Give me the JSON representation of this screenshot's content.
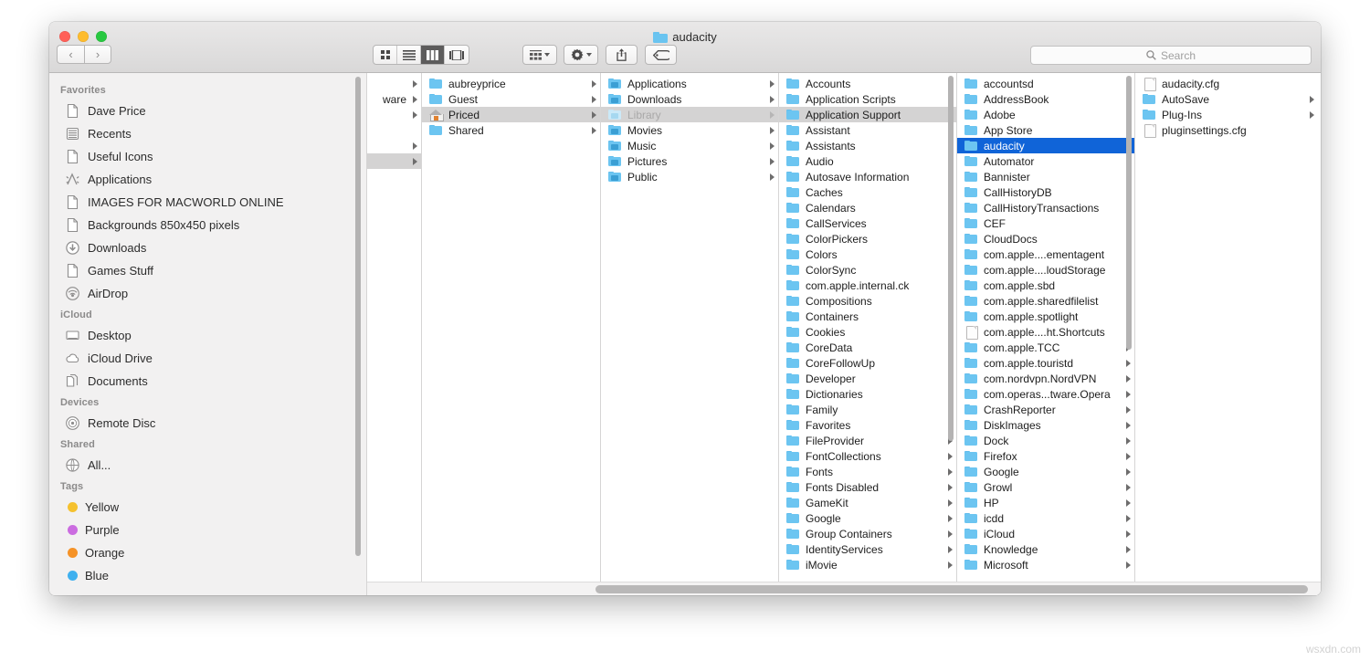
{
  "window": {
    "title": "audacity",
    "title_icon": "folder-icon",
    "traffic_lights": [
      "close-red",
      "minimize-yellow",
      "maximize-green"
    ],
    "back_glyph": "‹",
    "forward_glyph": "›"
  },
  "toolbar": {
    "view_modes": [
      {
        "name": "icon-view",
        "glyph": "∷",
        "active": false
      },
      {
        "name": "list-view",
        "glyph": "≡",
        "active": false
      },
      {
        "name": "column-view",
        "glyph": "███",
        "active": true
      },
      {
        "name": "gallery-view",
        "glyph": "|□|",
        "active": false
      }
    ],
    "arrange_label": "arrange-icon",
    "action_label": "⚙",
    "share_label": "⇧",
    "tag_label": "◇",
    "arrange_glyph": "∷∷",
    "gear_glyph": "⚙",
    "share_glyph": "⬆",
    "tag_glyph": "●"
  },
  "search": {
    "placeholder": "Search",
    "icon": "search-icon",
    "value": ""
  },
  "sidebar": {
    "sections": [
      {
        "header": "Favorites",
        "items": [
          {
            "label": "Dave Price",
            "icon": "document-icon"
          },
          {
            "label": "Recents",
            "icon": "recents-icon"
          },
          {
            "label": "Useful Icons",
            "icon": "document-icon"
          },
          {
            "label": "Applications",
            "icon": "applications-icon"
          },
          {
            "label": "IMAGES FOR MACWORLD ONLINE",
            "icon": "document-icon"
          },
          {
            "label": "Backgrounds 850x450 pixels",
            "icon": "document-icon"
          },
          {
            "label": "Downloads",
            "icon": "downloads-icon"
          },
          {
            "label": "Games Stuff",
            "icon": "document-icon"
          },
          {
            "label": "AirDrop",
            "icon": "airdrop-icon"
          }
        ]
      },
      {
        "header": "iCloud",
        "items": [
          {
            "label": "Desktop",
            "icon": "desktop-icon"
          },
          {
            "label": "iCloud Drive",
            "icon": "cloud-icon"
          },
          {
            "label": "Documents",
            "icon": "documents-icon"
          }
        ]
      },
      {
        "header": "Devices",
        "items": [
          {
            "label": "Remote Disc",
            "icon": "disc-icon"
          }
        ]
      },
      {
        "header": "Shared",
        "items": [
          {
            "label": "All...",
            "icon": "globe-icon"
          }
        ]
      },
      {
        "header": "Tags",
        "items": [
          {
            "label": "Yellow",
            "icon": "tag-dot",
            "color": "#f5c12e"
          },
          {
            "label": "Purple",
            "icon": "tag-dot",
            "color": "#cb6ce0"
          },
          {
            "label": "Orange",
            "icon": "tag-dot",
            "color": "#f59227"
          },
          {
            "label": "Blue",
            "icon": "tag-dot",
            "color": "#3fb0ef"
          }
        ]
      }
    ]
  },
  "columns": [
    {
      "name": "column-partial",
      "truncated_label": "ware",
      "rows": [
        {
          "label": "",
          "icon": "none",
          "chevron": true,
          "state": "normal"
        },
        {
          "label": "ware",
          "icon": "none",
          "chevron": true,
          "state": "normal"
        },
        {
          "label": "",
          "icon": "none",
          "chevron": true,
          "state": "normal"
        },
        {
          "label": "",
          "icon": "none",
          "chevron": false,
          "state": "normal"
        },
        {
          "label": "",
          "icon": "none",
          "chevron": true,
          "state": "normal"
        },
        {
          "label": "",
          "icon": "none",
          "chevron": true,
          "state": "selected-inactive"
        }
      ]
    },
    {
      "name": "column-users",
      "rows": [
        {
          "label": "aubreyprice",
          "icon": "folder-icon",
          "chevron": true,
          "state": "normal"
        },
        {
          "label": "Guest",
          "icon": "folder-icon",
          "chevron": true,
          "state": "normal"
        },
        {
          "label": "Priced",
          "icon": "home-icon",
          "chevron": true,
          "state": "selected-inactive"
        },
        {
          "label": "Shared",
          "icon": "folder-icon",
          "chevron": true,
          "state": "normal"
        }
      ]
    },
    {
      "name": "column-home",
      "rows": [
        {
          "label": "Applications",
          "icon": "folder-app-icon",
          "chevron": true,
          "state": "normal"
        },
        {
          "label": "Downloads",
          "icon": "folder-downloads-icon",
          "chevron": true,
          "state": "normal"
        },
        {
          "label": "Library",
          "icon": "folder-library-icon",
          "chevron": true,
          "state": "selected-inactive-dim"
        },
        {
          "label": "Movies",
          "icon": "folder-movies-icon",
          "chevron": true,
          "state": "normal"
        },
        {
          "label": "Music",
          "icon": "folder-music-icon",
          "chevron": true,
          "state": "normal"
        },
        {
          "label": "Pictures",
          "icon": "folder-pictures-icon",
          "chevron": true,
          "state": "normal"
        },
        {
          "label": "Public",
          "icon": "folder-public-icon",
          "chevron": true,
          "state": "normal"
        }
      ]
    },
    {
      "name": "column-library",
      "scrollbar": true,
      "rows": [
        {
          "label": "Accounts",
          "icon": "folder-icon",
          "chevron": true,
          "state": "normal"
        },
        {
          "label": "Application Scripts",
          "icon": "folder-icon",
          "chevron": true,
          "state": "normal"
        },
        {
          "label": "Application Support",
          "icon": "folder-icon",
          "chevron": true,
          "state": "selected-inactive"
        },
        {
          "label": "Assistant",
          "icon": "folder-icon",
          "chevron": true,
          "state": "normal"
        },
        {
          "label": "Assistants",
          "icon": "folder-icon",
          "chevron": true,
          "state": "normal"
        },
        {
          "label": "Audio",
          "icon": "folder-icon",
          "chevron": true,
          "state": "normal"
        },
        {
          "label": "Autosave Information",
          "icon": "folder-icon",
          "chevron": true,
          "state": "normal"
        },
        {
          "label": "Caches",
          "icon": "folder-icon",
          "chevron": true,
          "state": "normal"
        },
        {
          "label": "Calendars",
          "icon": "folder-icon",
          "chevron": true,
          "state": "normal"
        },
        {
          "label": "CallServices",
          "icon": "folder-icon",
          "chevron": true,
          "state": "normal"
        },
        {
          "label": "ColorPickers",
          "icon": "folder-icon",
          "chevron": true,
          "state": "normal"
        },
        {
          "label": "Colors",
          "icon": "folder-icon",
          "chevron": true,
          "state": "normal"
        },
        {
          "label": "ColorSync",
          "icon": "folder-icon",
          "chevron": true,
          "state": "normal"
        },
        {
          "label": "com.apple.internal.ck",
          "icon": "folder-icon",
          "chevron": true,
          "state": "normal"
        },
        {
          "label": "Compositions",
          "icon": "folder-icon",
          "chevron": true,
          "state": "normal"
        },
        {
          "label": "Containers",
          "icon": "folder-icon",
          "chevron": true,
          "state": "normal"
        },
        {
          "label": "Cookies",
          "icon": "folder-icon",
          "chevron": true,
          "state": "normal"
        },
        {
          "label": "CoreData",
          "icon": "folder-icon",
          "chevron": true,
          "state": "normal"
        },
        {
          "label": "CoreFollowUp",
          "icon": "folder-icon",
          "chevron": true,
          "state": "normal"
        },
        {
          "label": "Developer",
          "icon": "folder-icon",
          "chevron": true,
          "state": "normal"
        },
        {
          "label": "Dictionaries",
          "icon": "folder-icon",
          "chevron": true,
          "state": "normal"
        },
        {
          "label": "Family",
          "icon": "folder-icon",
          "chevron": true,
          "state": "normal"
        },
        {
          "label": "Favorites",
          "icon": "folder-icon",
          "chevron": true,
          "state": "normal"
        },
        {
          "label": "FileProvider",
          "icon": "folder-icon",
          "chevron": true,
          "state": "normal"
        },
        {
          "label": "FontCollections",
          "icon": "folder-icon",
          "chevron": true,
          "state": "normal"
        },
        {
          "label": "Fonts",
          "icon": "folder-icon",
          "chevron": true,
          "state": "normal"
        },
        {
          "label": "Fonts Disabled",
          "icon": "folder-icon",
          "chevron": true,
          "state": "normal"
        },
        {
          "label": "GameKit",
          "icon": "folder-icon",
          "chevron": true,
          "state": "normal"
        },
        {
          "label": "Google",
          "icon": "folder-icon",
          "chevron": true,
          "state": "normal"
        },
        {
          "label": "Group Containers",
          "icon": "folder-icon",
          "chevron": true,
          "state": "normal"
        },
        {
          "label": "IdentityServices",
          "icon": "folder-icon",
          "chevron": true,
          "state": "normal"
        },
        {
          "label": "iMovie",
          "icon": "folder-icon",
          "chevron": true,
          "state": "normal"
        }
      ]
    },
    {
      "name": "column-application-support",
      "scrollbar": true,
      "rows": [
        {
          "label": "accountsd",
          "icon": "folder-icon",
          "chevron": true,
          "state": "normal"
        },
        {
          "label": "AddressBook",
          "icon": "folder-icon",
          "chevron": true,
          "state": "normal"
        },
        {
          "label": "Adobe",
          "icon": "folder-icon",
          "chevron": true,
          "state": "normal"
        },
        {
          "label": "App Store",
          "icon": "folder-icon",
          "chevron": true,
          "state": "normal"
        },
        {
          "label": "audacity",
          "icon": "folder-icon",
          "chevron": true,
          "state": "selected-active"
        },
        {
          "label": "Automator",
          "icon": "folder-icon",
          "chevron": true,
          "state": "normal"
        },
        {
          "label": "Bannister",
          "icon": "folder-icon",
          "chevron": true,
          "state": "normal"
        },
        {
          "label": "CallHistoryDB",
          "icon": "folder-icon",
          "chevron": true,
          "state": "normal"
        },
        {
          "label": "CallHistoryTransactions",
          "icon": "folder-icon",
          "chevron": true,
          "state": "normal"
        },
        {
          "label": "CEF",
          "icon": "folder-icon",
          "chevron": true,
          "state": "normal"
        },
        {
          "label": "CloudDocs",
          "icon": "folder-icon",
          "chevron": true,
          "state": "normal"
        },
        {
          "label": "com.apple....ementagent",
          "icon": "folder-icon",
          "chevron": true,
          "state": "normal"
        },
        {
          "label": "com.apple....loudStorage",
          "icon": "folder-icon",
          "chevron": true,
          "state": "normal"
        },
        {
          "label": "com.apple.sbd",
          "icon": "folder-icon",
          "chevron": true,
          "state": "normal"
        },
        {
          "label": "com.apple.sharedfilelist",
          "icon": "folder-icon",
          "chevron": true,
          "state": "normal"
        },
        {
          "label": "com.apple.spotlight",
          "icon": "folder-icon",
          "chevron": true,
          "state": "normal"
        },
        {
          "label": "com.apple....ht.Shortcuts",
          "icon": "document-icon",
          "chevron": false,
          "state": "normal"
        },
        {
          "label": "com.apple.TCC",
          "icon": "folder-icon",
          "chevron": true,
          "state": "normal"
        },
        {
          "label": "com.apple.touristd",
          "icon": "folder-icon",
          "chevron": true,
          "state": "normal"
        },
        {
          "label": "com.nordvpn.NordVPN",
          "icon": "folder-icon",
          "chevron": true,
          "state": "normal"
        },
        {
          "label": "com.operas...tware.Opera",
          "icon": "folder-icon",
          "chevron": true,
          "state": "normal"
        },
        {
          "label": "CrashReporter",
          "icon": "folder-icon",
          "chevron": true,
          "state": "normal"
        },
        {
          "label": "DiskImages",
          "icon": "folder-icon",
          "chevron": true,
          "state": "normal"
        },
        {
          "label": "Dock",
          "icon": "folder-icon",
          "chevron": true,
          "state": "normal"
        },
        {
          "label": "Firefox",
          "icon": "folder-icon",
          "chevron": true,
          "state": "normal"
        },
        {
          "label": "Google",
          "icon": "folder-icon",
          "chevron": true,
          "state": "normal"
        },
        {
          "label": "Growl",
          "icon": "folder-icon",
          "chevron": true,
          "state": "normal"
        },
        {
          "label": "HP",
          "icon": "folder-icon",
          "chevron": true,
          "state": "normal"
        },
        {
          "label": "icdd",
          "icon": "folder-icon",
          "chevron": true,
          "state": "normal"
        },
        {
          "label": "iCloud",
          "icon": "folder-icon",
          "chevron": true,
          "state": "normal"
        },
        {
          "label": "Knowledge",
          "icon": "folder-icon",
          "chevron": true,
          "state": "normal"
        },
        {
          "label": "Microsoft",
          "icon": "folder-icon",
          "chevron": true,
          "state": "normal"
        }
      ]
    },
    {
      "name": "column-audacity",
      "rows": [
        {
          "label": "audacity.cfg",
          "icon": "document-icon",
          "chevron": false,
          "state": "normal"
        },
        {
          "label": "AutoSave",
          "icon": "folder-icon",
          "chevron": true,
          "state": "normal"
        },
        {
          "label": "Plug-Ins",
          "icon": "folder-icon",
          "chevron": true,
          "state": "normal"
        },
        {
          "label": "pluginsettings.cfg",
          "icon": "document-icon",
          "chevron": false,
          "state": "normal"
        }
      ]
    }
  ],
  "grip_glyph": "‖",
  "watermark": "wsxdn.com",
  "colors": {
    "selection_active": "#1064d8",
    "selection_inactive": "#d4d3d3",
    "folder_blue": "#6cc5f1",
    "sidebar_bg": "#f2f1f1"
  }
}
